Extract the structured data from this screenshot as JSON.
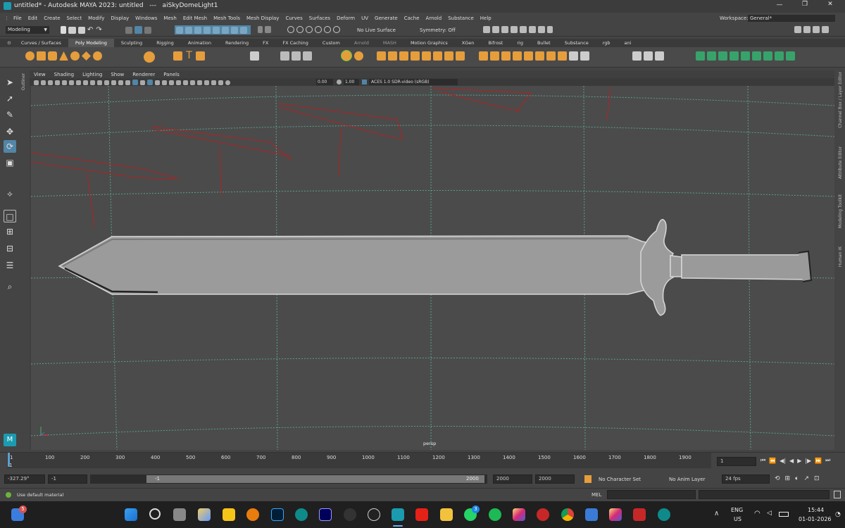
{
  "titlebar": {
    "title": "untitled* - Autodesk MAYA 2023: untitled   ---   aiSkyDomeLight1"
  },
  "menubar": {
    "items": [
      "File",
      "Edit",
      "Create",
      "Select",
      "Modify",
      "Display",
      "Windows",
      "Mesh",
      "Edit Mesh",
      "Mesh Tools",
      "Mesh Display",
      "Curves",
      "Surfaces",
      "Deform",
      "UV",
      "Generate",
      "Cache",
      "Arnold",
      "Substance",
      "Help"
    ],
    "workspace_label": "Workspace:",
    "workspace_value": "General*"
  },
  "statusline": {
    "menuset": "Modeling",
    "live_surface": "No Live Surface",
    "symmetry": "Symmetry: Off"
  },
  "shelf": {
    "tabs": [
      "Curves / Surfaces",
      "Poly Modeling",
      "Sculpting",
      "Rigging",
      "Animation",
      "Rendering",
      "FX",
      "FX Caching",
      "Custom",
      "Arnold",
      "MASH",
      "Motion Graphics",
      "XGen",
      "Bifrost",
      "rig",
      "Bullet",
      "Substance",
      "rgb",
      "ani"
    ],
    "active_tab": "Poly Modeling"
  },
  "viewport": {
    "menu": [
      "View",
      "Shading",
      "Lighting",
      "Show",
      "Renderer",
      "Panels"
    ],
    "exposure": "0.00",
    "gamma": "1.00",
    "color_space": "ACES 1.0 SDR-video (sRGB)",
    "camera_label": "persp"
  },
  "side_panels": [
    "Channel Box / Layer Editor",
    "Attribute Editor",
    "Modeling Toolkit",
    "Human IK"
  ],
  "outliner_label": "Outliner",
  "timeline": {
    "ticks": [
      "1",
      "100",
      "200",
      "300",
      "400",
      "500",
      "600",
      "700",
      "800",
      "900",
      "1000",
      "1100",
      "1200",
      "1300",
      "1400",
      "1500",
      "1600",
      "1700",
      "1800",
      "1900"
    ],
    "current_frame": "1"
  },
  "rangebar": {
    "field1": "-327.29°",
    "field2": "-1",
    "slider_start": "-1",
    "slider_end": "2000",
    "range_end": "2000",
    "anim_end": "2000",
    "character_set": "No Character Set",
    "anim_layer": "No Anim Layer",
    "fps": "24 fps"
  },
  "cmdline": {
    "help": "Use default material",
    "lang": "MEL"
  },
  "taskbar": {
    "lang1": "ENG",
    "lang2": "US",
    "time": "15:44",
    "date": "01-01-2026",
    "notif_badge": "5",
    "whatsapp_badge": "3"
  },
  "colors": {
    "accent": "#5285a6",
    "grid": "#5aa08f",
    "gizmo_red": "#b22222",
    "shelf_green": "#37a36b",
    "shelf_orange": "#e69d3c"
  }
}
